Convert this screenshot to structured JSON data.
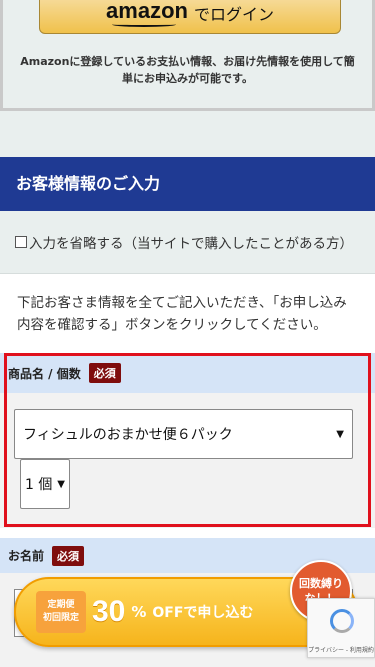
{
  "amazon": {
    "logo": "amazon",
    "login_label": "でログイン",
    "note": "Amazonに登録しているお支払い情報、お届け先情報を使用して簡単にお申込みが可能です。"
  },
  "section": {
    "title": "お客様情報のご入力"
  },
  "skip": {
    "label": "入力を省略する（当サイトで購入したことがある方）"
  },
  "intro": "下記お客さま情報を全てご記入いただき、「お申し込み内容を確認する」ボタンをクリックしてください。",
  "product_field": {
    "label": "商品名 / 個数",
    "required": "必須",
    "product_selected": "フィシュルのおまかせ便６パック",
    "qty_selected": "1 個"
  },
  "name_field": {
    "label": "お名前",
    "required": "必須"
  },
  "promo": {
    "tag_line1": "定期便",
    "tag_line2": "初回限定",
    "discount": "30",
    "percent": "%",
    "off_text": "OFFで申し込む",
    "badge": "回数縛り なし！"
  },
  "recaptcha": {
    "text": "プライバシー - 利用規約"
  },
  "colors": {
    "header_blue": "#1f3a93",
    "required_red": "#7f0d0d",
    "highlight_red": "#e0101c",
    "promo_yellow": "#f6b41c"
  }
}
